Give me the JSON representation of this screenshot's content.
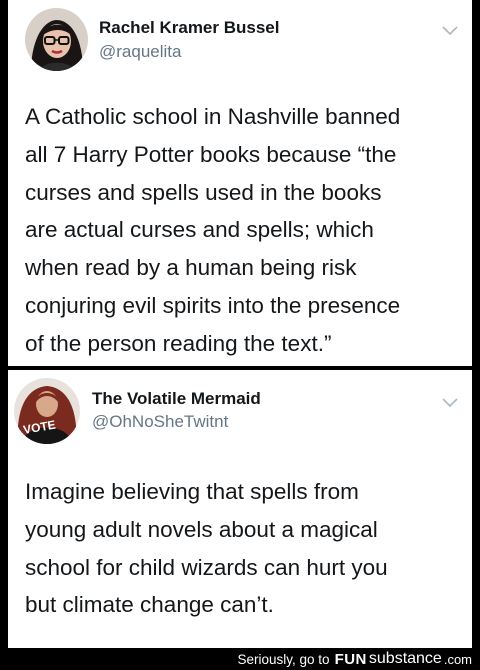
{
  "tweets": [
    {
      "display_name": "Rachel Kramer Bussel",
      "handle": "@raquelita",
      "avatar_icon": "person-with-glasses-avatar",
      "text_lines": [
        "A Catholic school in Nashville banned",
        "all 7 Harry Potter books because “the",
        "curses and spells used in the books",
        "are actual curses and spells; which",
        "when read by a human being risk",
        "conjuring evil spirits into the presence",
        "of the person reading the text.”"
      ]
    },
    {
      "display_name": "The Volatile Mermaid",
      "handle": "@OhNoSheTwitnt",
      "avatar_icon": "vote-shirt-avatar",
      "avatar_text": "VOTE",
      "text_lines": [
        "Imagine believing that spells from",
        "young adult novels about a magical",
        "school for child wizards can hurt you",
        "but climate change can’t."
      ]
    }
  ],
  "footer": {
    "prefix": "Seriously, go to",
    "brand_fun": "FUN",
    "brand_substance": "substance",
    "brand_tld": ".com"
  },
  "colors": {
    "background": "#000000",
    "card": "#ffffff",
    "name": "#14171a",
    "handle": "#657786",
    "chevron": "#aab8c2"
  }
}
